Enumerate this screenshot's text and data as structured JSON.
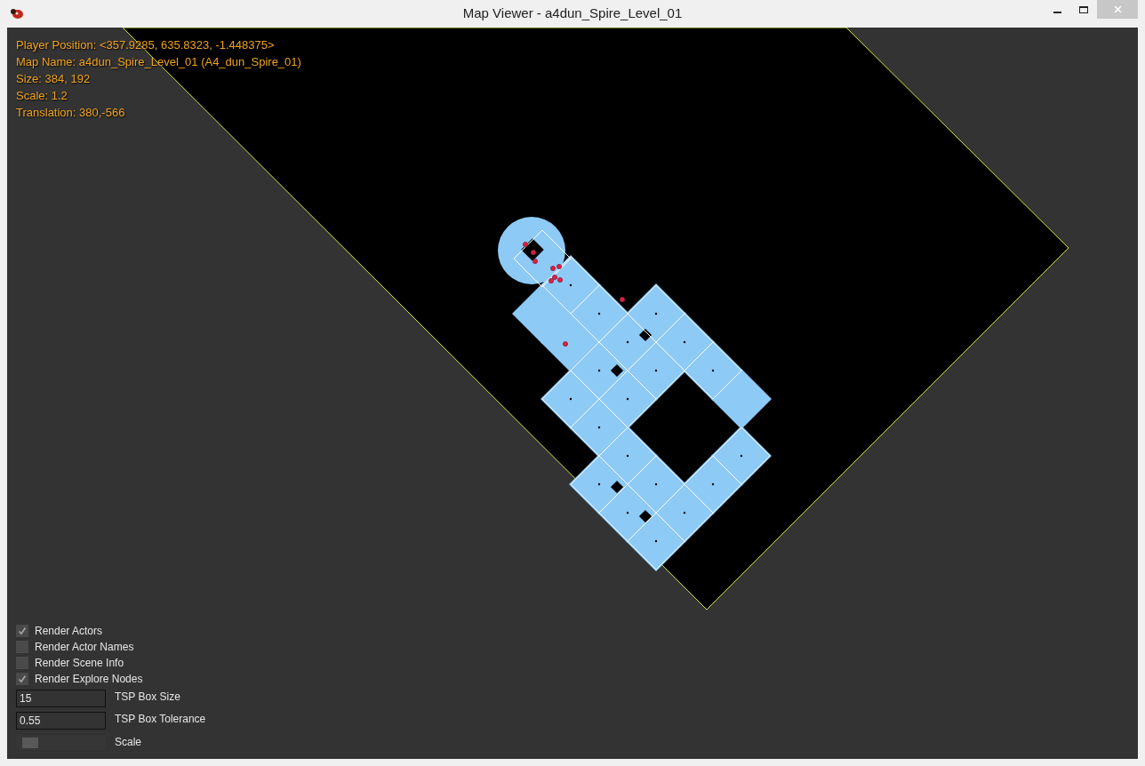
{
  "window": {
    "title": "Map Viewer - a4dun_Spire_Level_01"
  },
  "info_lines": [
    "Player Position: <357.9285, 635.8323, -1.448375>",
    "Map Name: a4dun_Spire_Level_01 (A4_dun_Spire_01)",
    "Size: 384, 192",
    "Scale: 1.2",
    "Translation: 380,-566"
  ],
  "options": [
    {
      "label": "Render Actors",
      "checked": true
    },
    {
      "label": "Render Actor Names",
      "checked": false
    },
    {
      "label": "Render Scene Info",
      "checked": false
    },
    {
      "label": "Render Explore Nodes",
      "checked": true
    }
  ],
  "fields": [
    {
      "value": "15",
      "label": "TSP Box Size"
    },
    {
      "value": "0.55",
      "label": "TSP Box Tolerance"
    }
  ],
  "slider": {
    "label": "Scale",
    "level": 0.09
  }
}
